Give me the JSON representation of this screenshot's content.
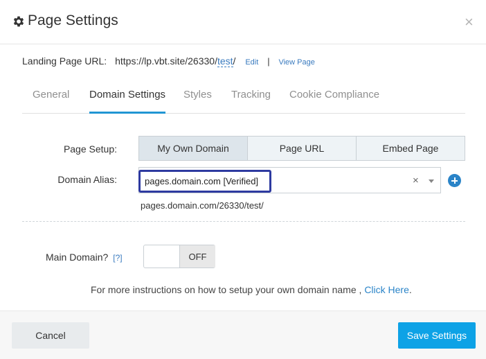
{
  "header": {
    "title": "Page Settings",
    "icon": "gear-icon",
    "close_glyph": "×"
  },
  "url_row": {
    "label": "Landing Page URL:",
    "url_base": "https://lp.vbt.site/26330/",
    "url_slug": "test",
    "url_trail": "/",
    "edit_label": "Edit",
    "separator": "|",
    "view_label": "View Page"
  },
  "tabs": [
    {
      "label": "General",
      "active": false
    },
    {
      "label": "Domain Settings",
      "active": true
    },
    {
      "label": "Styles",
      "active": false
    },
    {
      "label": "Tracking",
      "active": false
    },
    {
      "label": "Cookie Compliance",
      "active": false
    }
  ],
  "page_setup": {
    "label": "Page Setup:",
    "options": [
      "My Own Domain",
      "Page URL",
      "Embed Page"
    ],
    "selected": "My Own Domain"
  },
  "domain_alias": {
    "label": "Domain Alias:",
    "selected_value": "pages.domain.com [Verified]",
    "clear_glyph": "×",
    "full_url": "pages.domain.com/26330/test/"
  },
  "main_domain": {
    "label": "Main Domain?",
    "help": "[?]",
    "toggle_state": "OFF"
  },
  "instructions": {
    "text": "For more instructions on how to setup your own domain name , ",
    "link": "Click Here",
    "trail": "."
  },
  "footer": {
    "cancel_label": "Cancel",
    "save_label": "Save Settings"
  },
  "colors": {
    "accent": "#2196d3",
    "save_button": "#0da2e6",
    "link": "#3a7bbf",
    "chip_border": "#2e3aa0"
  }
}
